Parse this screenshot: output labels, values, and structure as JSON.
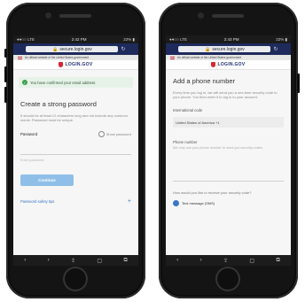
{
  "left_phone": {
    "status": {
      "carrier": "●●○○ LTE",
      "time": "2:42 PM",
      "battery": "22% ▮"
    },
    "browser": {
      "url": "secure.login.gov",
      "lock_icon": "lock-icon",
      "reload_icon": "reload-icon"
    },
    "gov_banner": "An official website of the United States government",
    "brand": "LOGIN.GOV",
    "alert": "You have confirmed your email address",
    "heading": "Create a strong password",
    "description": "It should be at least 12 characters long and not include any common words. Password must be unique.",
    "password_label": "Password",
    "show_password": "Show password",
    "password_hint": "Enter password",
    "continue_button": "Continue",
    "tips_link": "Password safety tips",
    "tips_plus": "+",
    "toolbar": [
      "‹",
      "›",
      "⇪",
      "▢",
      "⧉"
    ]
  },
  "right_phone": {
    "status": {
      "carrier": "●●○○ LTE",
      "time": "2:43 PM",
      "battery": "22% ▮"
    },
    "browser": {
      "url": "secure.login.gov",
      "lock_icon": "lock-icon",
      "reload_icon": "reload-icon"
    },
    "gov_banner": "An official website of the United States government",
    "brand": "LOGIN.GOV",
    "heading": "Add a phone number",
    "description": "Every time you log in, we will send you a one-time security code to your phone. You then enter it to log in to your account.",
    "intl_label": "International code",
    "intl_value": "United States of America +1",
    "phone_label": "Phone number",
    "phone_help": "We only use your phone number to send you security codes.",
    "question": "How would you like to receive your security code?",
    "option_text": "Text message (SMS)",
    "toolbar": [
      "‹",
      "›",
      "⇪",
      "▢",
      "⧉"
    ]
  },
  "colors": {
    "brand_navy": "#1f2f6e",
    "brand_red": "#d8262f",
    "button_blue": "#8fbfe8",
    "link_blue": "#3b76c7",
    "success_green": "#3aa04b"
  }
}
